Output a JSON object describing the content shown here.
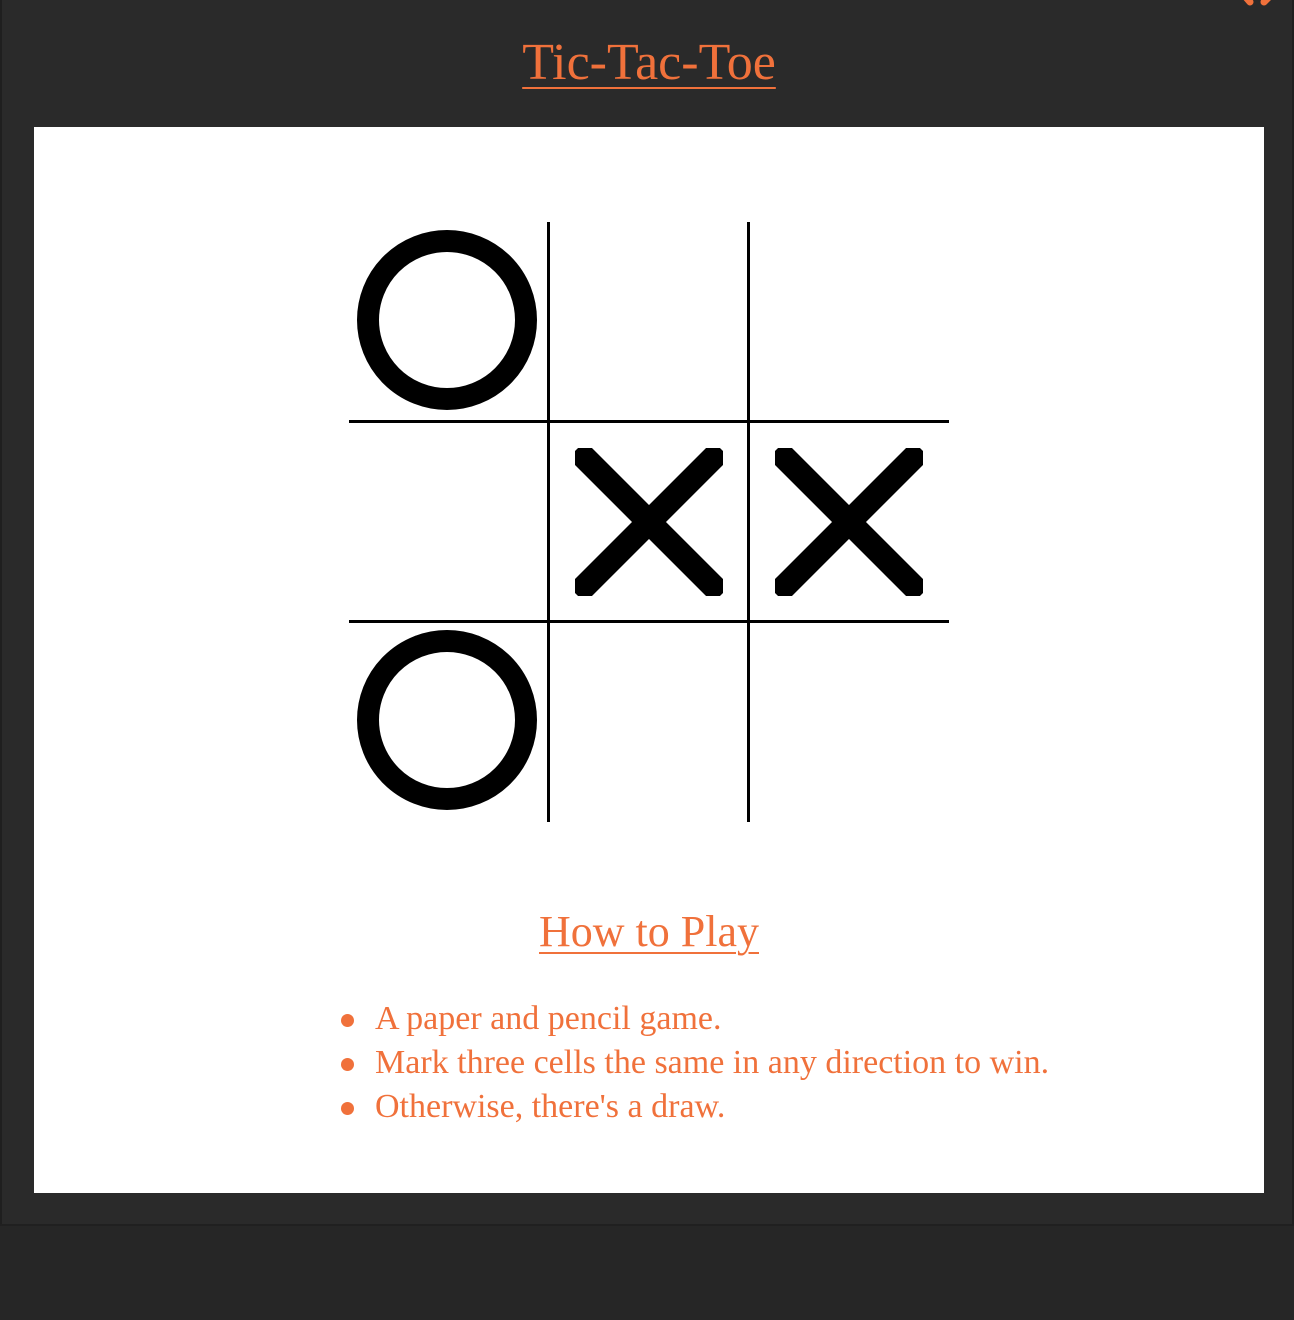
{
  "header": {
    "title": "Tic-Tac-Toe"
  },
  "board": {
    "cells": [
      "O",
      "",
      "",
      "",
      "X",
      "X",
      "O",
      "",
      ""
    ]
  },
  "instructions": {
    "heading": "How to Play",
    "rules": [
      "A paper and pencil game.",
      "Mark three cells the same in any direction to win.",
      "Otherwise, there's a draw."
    ]
  },
  "colors": {
    "background": "#2a2a2a",
    "accent": "#f0713b",
    "panel": "#ffffff",
    "mark": "#000000"
  },
  "icons": {
    "corner": "close-icon"
  }
}
